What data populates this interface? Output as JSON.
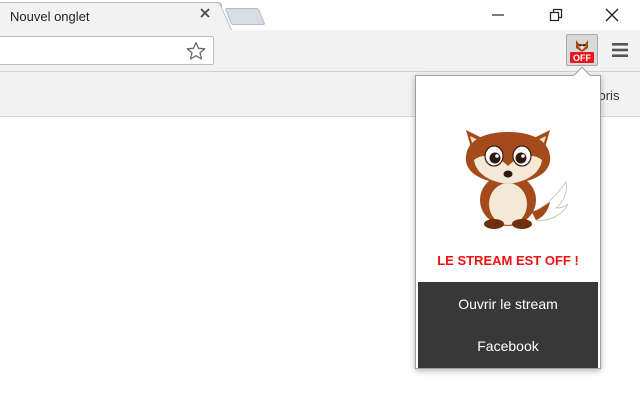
{
  "browser": {
    "tab": {
      "title": "Nouvel onglet",
      "close_icon": "close-icon"
    },
    "window_controls": [
      "minimize-icon",
      "maximize-icon",
      "close-icon"
    ],
    "omnibox": {
      "value": "",
      "placeholder": ""
    },
    "bookmarks_bar": {
      "visible_label": "voris"
    }
  },
  "extension": {
    "icon": "fox-off-badge-icon",
    "badge_text": "OFF",
    "badge_color": "#e8161c"
  },
  "popup": {
    "status_text": "LE STREAM EST OFF !",
    "status_color": "#ee1111",
    "buttons": [
      {
        "label": "Ouvrir le stream"
      },
      {
        "label": "Facebook"
      }
    ],
    "button_panel_color": "#383838"
  }
}
